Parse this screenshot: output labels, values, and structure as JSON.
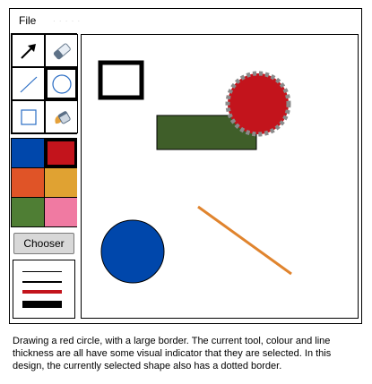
{
  "menu": {
    "file_label": "File",
    "faint_text": "· · · · ·"
  },
  "toolbar": {
    "tools": [
      {
        "name": "select-tool",
        "icon": "arrow-icon",
        "selected": false
      },
      {
        "name": "eraser-tool",
        "icon": "eraser-icon",
        "selected": false
      },
      {
        "name": "line-tool",
        "icon": "line-icon",
        "selected": false
      },
      {
        "name": "circle-tool",
        "icon": "circle-icon",
        "selected": true
      },
      {
        "name": "rectangle-tool",
        "icon": "square-icon",
        "selected": false
      },
      {
        "name": "fill-tool",
        "icon": "paint-bucket-icon",
        "selected": false
      }
    ],
    "colors": [
      {
        "name": "blue",
        "hex": "#0047ab",
        "selected": false
      },
      {
        "name": "red",
        "hex": "#c3141c",
        "selected": true
      },
      {
        "name": "orange-red",
        "hex": "#e05427",
        "selected": false
      },
      {
        "name": "amber",
        "hex": "#e0a232",
        "selected": false
      },
      {
        "name": "green",
        "hex": "#4f7e34",
        "selected": false
      },
      {
        "name": "pink",
        "hex": "#f07aa2",
        "selected": false
      }
    ],
    "chooser_label": "Chooser",
    "line_thickness_levels": [
      1,
      2,
      4,
      8
    ],
    "selected_line_thickness": 4
  },
  "canvas": {
    "shapes": [
      {
        "type": "rectangle",
        "fill": "none",
        "stroke": "#000000",
        "description": "hollow black square"
      },
      {
        "type": "rectangle",
        "fill": "#3f5e29",
        "stroke": "#000000",
        "description": "green rectangle"
      },
      {
        "type": "circle",
        "fill": "#c3141c",
        "stroke": "#8a8a8a",
        "selected": true,
        "description": "red circle with dotted border"
      },
      {
        "type": "circle",
        "fill": "#0047ab",
        "stroke": "#000000",
        "description": "blue circle"
      },
      {
        "type": "line",
        "stroke": "#e0842e",
        "description": "orange line"
      }
    ]
  },
  "caption": "Drawing a red circle, with a large border. The current tool, colour and line thickness are all have some visual indicator that they are selected. In this design, the currently selected shape also has a dotted border."
}
